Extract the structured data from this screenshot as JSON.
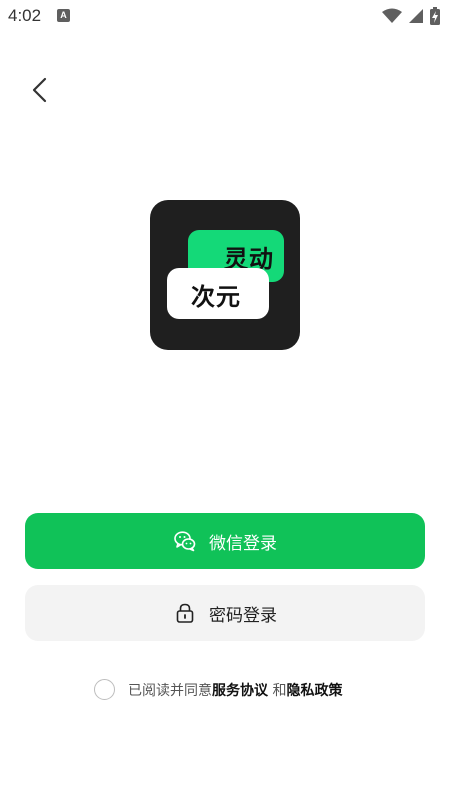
{
  "status_bar": {
    "time": "4:02",
    "notification_badge": "A",
    "icons": [
      "wifi-icon",
      "signal-icon",
      "battery-charging-icon"
    ]
  },
  "nav": {
    "back_icon": "chevron-left-icon"
  },
  "logo": {
    "line1": "灵动",
    "line2": "次元",
    "colors": {
      "background": "#1f1f1f",
      "green_bubble": "#14d978",
      "white_bubble": "#ffffff"
    }
  },
  "buttons": {
    "wechat_login": {
      "label": "微信登录",
      "icon": "wechat-icon",
      "color": "#10c258"
    },
    "password_login": {
      "label": "密码登录",
      "icon": "lock-icon",
      "color": "#f3f3f3"
    }
  },
  "agreement": {
    "checked": false,
    "prefix": "已阅读并同意",
    "terms_link": "服务协议",
    "conjunction": " 和",
    "privacy_link": "隐私政策"
  }
}
